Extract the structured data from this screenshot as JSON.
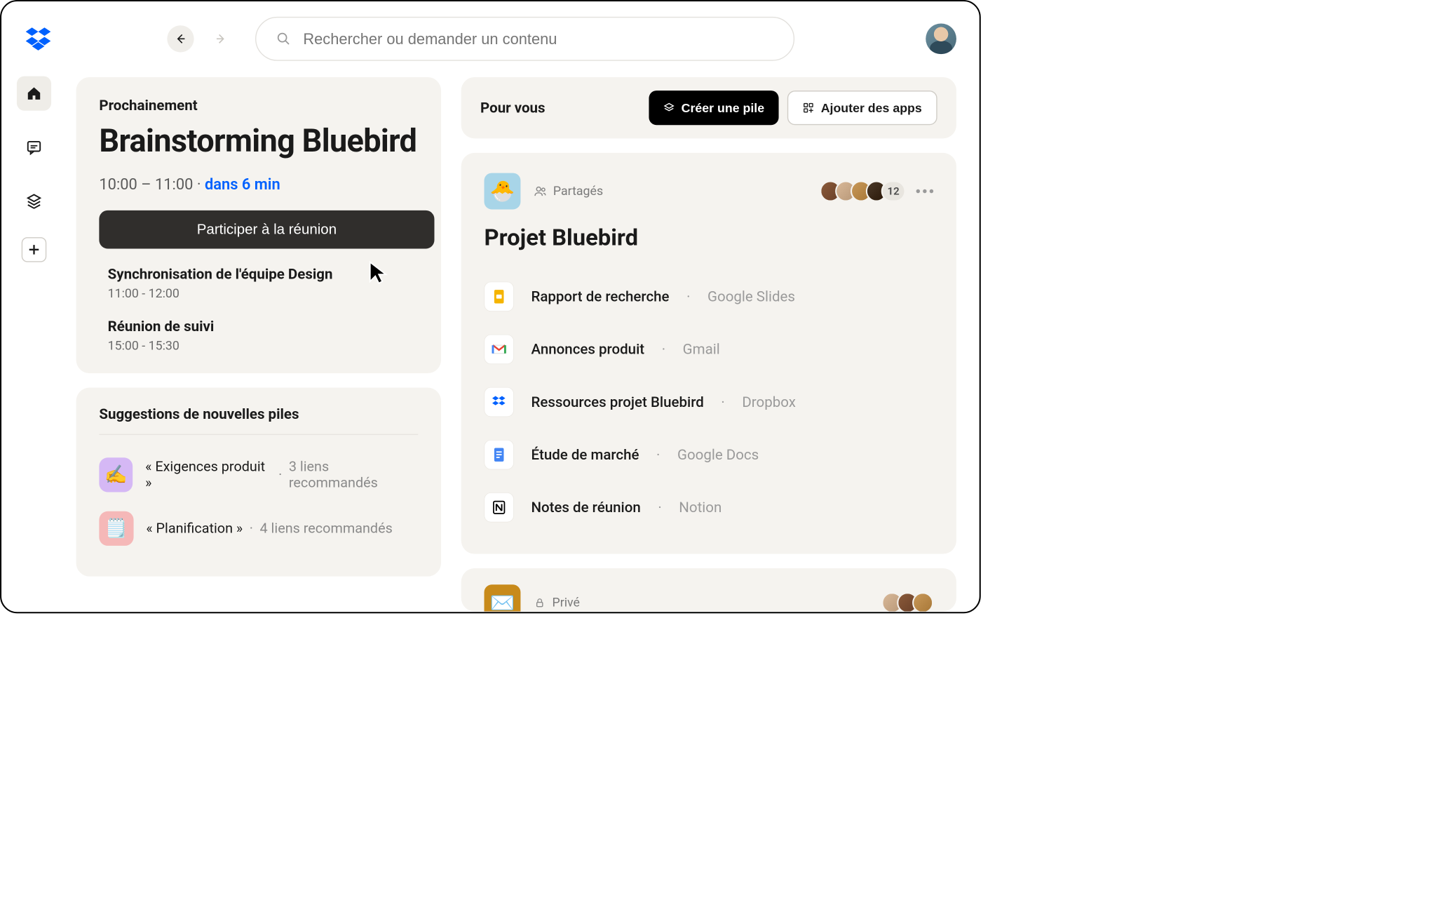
{
  "search": {
    "placeholder": "Rechercher ou demander un contenu"
  },
  "upcoming": {
    "label": "Prochainement",
    "title": "Brainstorming Bluebird",
    "time_range": "10:00 – 11:00",
    "separator": " · ",
    "countdown": "dans 6 min",
    "join_label": "Participer à la réunion",
    "meetings": [
      {
        "title": "Synchronisation de l'équipe Design",
        "time": "11:00 - 12:00"
      },
      {
        "title": "Réunion de suivi",
        "time": "15:00 - 15:30"
      }
    ]
  },
  "suggestions": {
    "label": "Suggestions de nouvelles piles",
    "items": [
      {
        "emoji": "✍️",
        "name": "« Exigences produit »",
        "detail": "3 liens recommandés"
      },
      {
        "emoji": "🗒️",
        "name": "« Planification »",
        "detail": "4 liens recommandés"
      }
    ]
  },
  "for_you": {
    "title": "Pour vous",
    "create_label": "Créer une pile",
    "add_apps_label": "Ajouter des apps"
  },
  "stack1": {
    "emoji": "🐣",
    "shared_label": "Partagés",
    "avatar_overflow": "12",
    "title": "Projet Bluebird",
    "files": [
      {
        "name": "Rapport de recherche",
        "source": "Google Slides",
        "icon": "slides"
      },
      {
        "name": "Annonces produit",
        "source": "Gmail",
        "icon": "gmail"
      },
      {
        "name": "Ressources projet Bluebird",
        "source": "Dropbox",
        "icon": "dropbox"
      },
      {
        "name": "Étude de marché",
        "source": "Google Docs",
        "icon": "docs"
      },
      {
        "name": "Notes de réunion",
        "source": "Notion",
        "icon": "notion"
      }
    ]
  },
  "stack2": {
    "emoji": "✉️",
    "private_label": "Privé"
  }
}
